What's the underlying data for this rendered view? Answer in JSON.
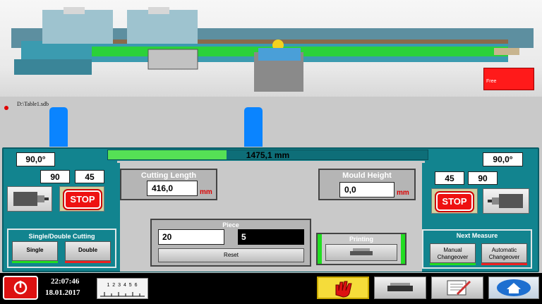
{
  "machine": {
    "status_text": "Free",
    "file_path": "D:\\Table1.sdb"
  },
  "length": {
    "value_text": "1475,1 mm",
    "progress": 0.37
  },
  "left": {
    "angle": "90,0°",
    "preset_a": "90",
    "preset_b": "45",
    "stop_label": "STOP"
  },
  "right": {
    "angle": "90,0°",
    "preset_a": "45",
    "preset_b": "90",
    "stop_label": "STOP"
  },
  "cutting_length": {
    "title": "Cutting Length",
    "value": "416,0",
    "unit": "mm"
  },
  "mould_height": {
    "title": "Mould Height",
    "value": "0,0",
    "unit": "mm"
  },
  "piece": {
    "title": "Piece",
    "value": "20",
    "count": "5",
    "reset_label": "Reset"
  },
  "printing": {
    "title": "Printing"
  },
  "single_double": {
    "title": "Single/Double Cutting",
    "single_label": "Single",
    "double_label": "Double"
  },
  "next_measure": {
    "title": "Next Measure",
    "manual_label": "Manual Changeover",
    "auto_label": "Automatic Changeover"
  },
  "footer": {
    "time": "22:07:46",
    "date": "18.01.2017",
    "ruler_digits": "1 2 3 4 5 6"
  },
  "colors": {
    "teal": "#12848f",
    "stop_red": "#e11111",
    "led_green": "#22dd22",
    "led_red": "#ee2222",
    "marker_blue": "#0a84ff"
  }
}
